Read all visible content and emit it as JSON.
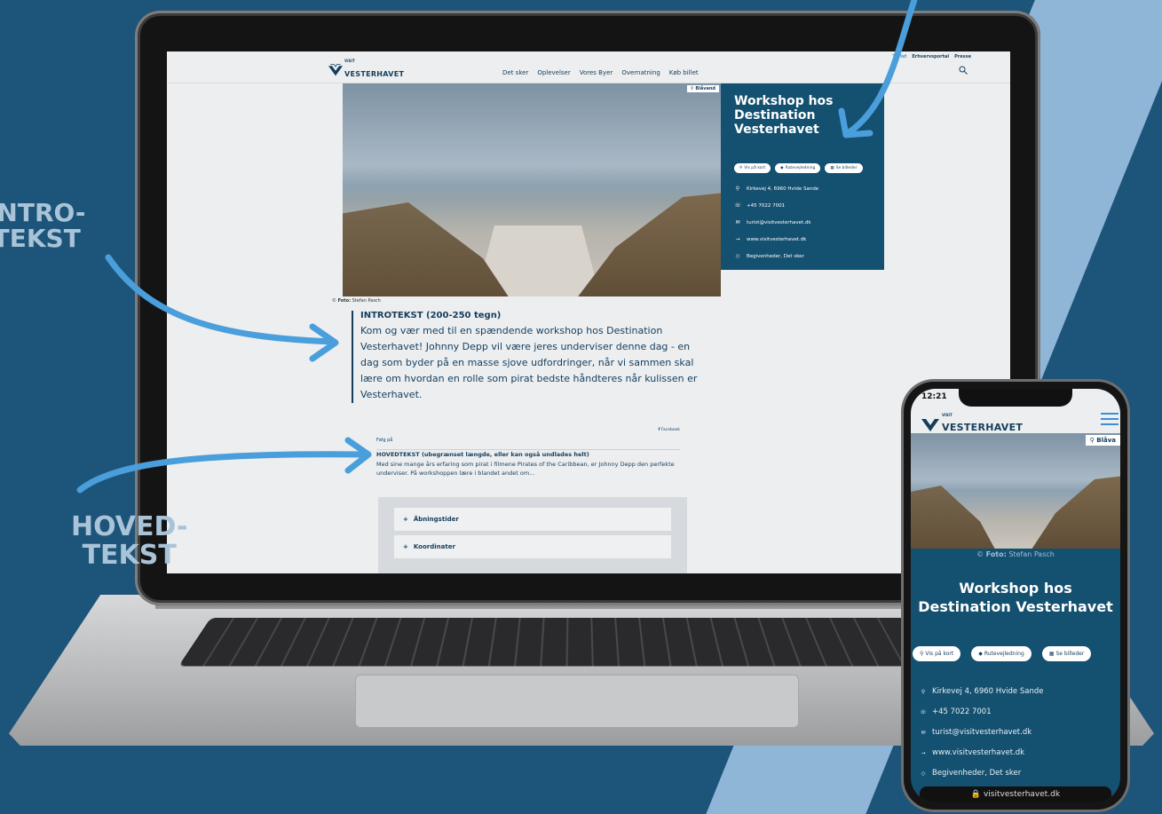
{
  "callouts": {
    "intro": "INTRO-\nTEKST",
    "hoved": "HOVED-\nTEKST"
  },
  "site": {
    "logo_visit": "VISIT",
    "logo_name": "VESTERHAVET",
    "top_links": [
      "Turist",
      "Erhvervsportal",
      "Presse"
    ],
    "nav": [
      "Det sker",
      "Oplevelser",
      "Vores Byer",
      "Overnatning",
      "Køb billet"
    ]
  },
  "hero": {
    "location": "Blåvand",
    "credit_label": "Foto:",
    "credit_name": "Stefan Pasch"
  },
  "event": {
    "title": "Workshop hos Destination Vesterhavet",
    "buttons": [
      "Vis på kort",
      "Rutevejledning",
      "Se billeder"
    ],
    "address": "Kirkevej 4, 6960 Hvide Sande",
    "phone": "+45 7022 7001",
    "email": "turist@visitvesterhavet.dk",
    "website": "www.visitvesterhavet.dk",
    "categories": "Begivenheder, Det sker"
  },
  "intro": {
    "heading": "INTROTEKST (200-250 tegn)",
    "text": "Kom og vær med til en spændende workshop hos Destination Vesterhavet! Johnny Depp vil være jeres underviser denne dag - en dag som byder på en masse sjove udfordringer, når vi sammen skal lære om hvordan en rolle som pirat bedste håndteres når kulissen er Vesterhavet."
  },
  "follow": {
    "label": "Følg på",
    "facebook": "Facebook"
  },
  "main_text": {
    "heading": "HOVEDTEKST (ubegrænset længde, eller kan også undlades helt)",
    "text": "Med sine mange års erfaring som pirat i filmene Pirates of the Caribbean, er Johnny Depp den perfekte underviser. På workshoppen lære i blandet andet om..."
  },
  "accordion": [
    "Åbningstider",
    "Koordinater"
  ],
  "phone": {
    "time": "12:21",
    "location": "Blåva",
    "title": "Workshop hos Destination Vesterhavet",
    "buttons": [
      "Vis på kort",
      "Rutevejledning",
      "Se billeder"
    ],
    "url": "visitvesterhavet.dk"
  },
  "colors": {
    "background": "#1d5479",
    "brand_dark": "#14506f",
    "accent_arrow": "#4a9edb",
    "callout": "#a9c3d8"
  },
  "icons": {
    "map_pin": "map-pin-icon",
    "route": "route-icon",
    "gallery": "grid-icon",
    "phone": "phone-icon",
    "mail": "mail-icon",
    "arrow": "arrow-right-icon",
    "tag": "tag-icon",
    "search": "search-icon",
    "menu": "hamburger-menu-icon"
  }
}
